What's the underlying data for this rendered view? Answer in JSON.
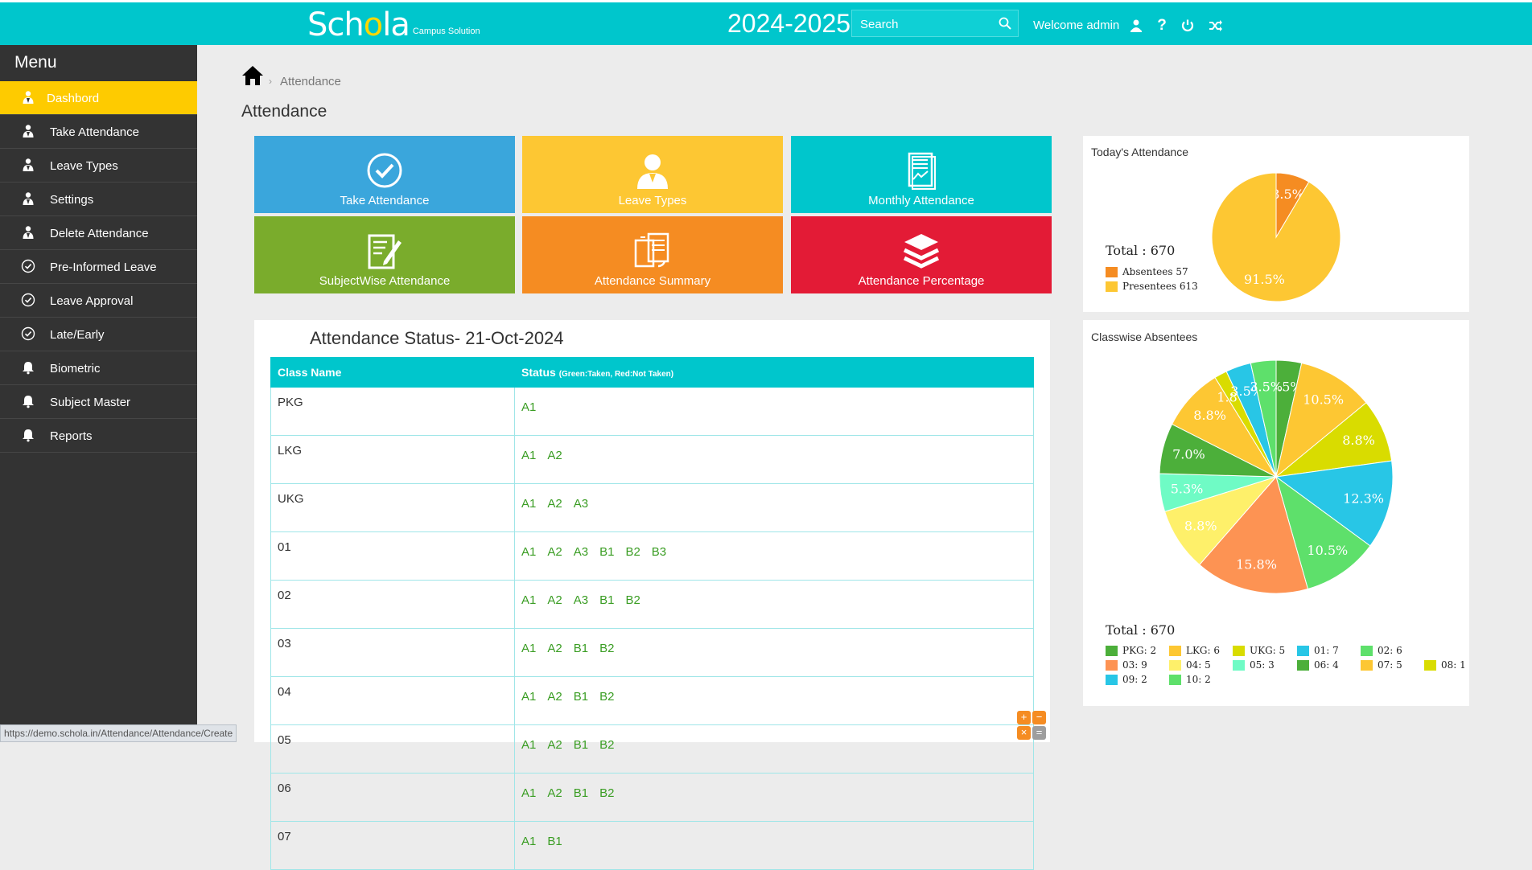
{
  "header": {
    "brand": "Schola",
    "brand_sub": "Campus Solution",
    "year": "2024-2025",
    "search_placeholder": "Search",
    "welcome": "Welcome admin"
  },
  "sidebar": {
    "title": "Menu",
    "items": [
      {
        "label": "Dashbord",
        "icon": "user-icon",
        "active": true
      },
      {
        "label": "Take Attendance",
        "icon": "user-icon"
      },
      {
        "label": "Leave Types",
        "icon": "user-icon"
      },
      {
        "label": "Settings",
        "icon": "user-icon"
      },
      {
        "label": "Delete Attendance",
        "icon": "user-icon"
      },
      {
        "label": "Pre-Informed Leave",
        "icon": "check-circle-icon"
      },
      {
        "label": "Leave Approval",
        "icon": "check-circle-icon"
      },
      {
        "label": "Late/Early",
        "icon": "check-circle-icon"
      },
      {
        "label": "Biometric",
        "icon": "bell-icon"
      },
      {
        "label": "Subject Master",
        "icon": "bell-icon"
      },
      {
        "label": "Reports",
        "icon": "bell-icon"
      }
    ]
  },
  "breadcrumb": {
    "current": "Attendance"
  },
  "page_title": "Attendance",
  "tiles": [
    {
      "label": "Take Attendance",
      "color": "#3aa6dc",
      "icon": "check-circle-icon"
    },
    {
      "label": "Leave Types",
      "color": "#fdc733",
      "icon": "person-icon"
    },
    {
      "label": "Monthly Attendance",
      "color": "#00c6cc",
      "icon": "report-icon"
    },
    {
      "label": "SubjectWise Attendance",
      "color": "#7aac2c",
      "icon": "edit-document-icon"
    },
    {
      "label": "Attendance Summary",
      "color": "#f58c22",
      "icon": "documents-icon"
    },
    {
      "label": "Attendance Percentage",
      "color": "#e31b36",
      "icon": "layers-icon"
    }
  ],
  "attendance_status": {
    "title": "Attendance Status- 21-Oct-2024",
    "col_class": "Class Name",
    "col_status": "Status",
    "col_status_note": "(Green:Taken, Red:Not Taken)",
    "rows": [
      {
        "class": "PKG",
        "sections": [
          "A1"
        ]
      },
      {
        "class": "LKG",
        "sections": [
          "A1",
          "A2"
        ]
      },
      {
        "class": "UKG",
        "sections": [
          "A1",
          "A2",
          "A3"
        ]
      },
      {
        "class": "01",
        "sections": [
          "A1",
          "A2",
          "A3",
          "B1",
          "B2",
          "B3"
        ]
      },
      {
        "class": "02",
        "sections": [
          "A1",
          "A2",
          "A3",
          "B1",
          "B2"
        ]
      },
      {
        "class": "03",
        "sections": [
          "A1",
          "A2",
          "B1",
          "B2"
        ]
      },
      {
        "class": "04",
        "sections": [
          "A1",
          "A2",
          "B1",
          "B2"
        ]
      },
      {
        "class": "05",
        "sections": [
          "A1",
          "A2",
          "B1",
          "B2"
        ]
      },
      {
        "class": "06",
        "sections": [
          "A1",
          "A2",
          "B1",
          "B2"
        ]
      },
      {
        "class": "07",
        "sections": [
          "A1",
          "B1"
        ]
      }
    ]
  },
  "chart_data": [
    {
      "type": "pie",
      "title": "Today's Attendance",
      "total_label": "Total : 670",
      "slices": [
        {
          "name": "Absentees 57",
          "value": 57,
          "label": "8.5%",
          "color": "#f58c22"
        },
        {
          "name": "Presentees 613",
          "value": 613,
          "label": "91.5%",
          "color": "#fdc733"
        }
      ]
    },
    {
      "type": "pie",
      "title": "Classwise Absentees",
      "total_label": "Total : 670",
      "slices": [
        {
          "name": "PKG: 2",
          "value": 2,
          "label": "3.5%",
          "color": "#4caf3a"
        },
        {
          "name": "LKG: 6",
          "value": 6,
          "label": "10.5%",
          "color": "#fdc733"
        },
        {
          "name": "UKG: 5",
          "value": 5,
          "label": "8.8%",
          "color": "#d9dc00"
        },
        {
          "name": "01: 7",
          "value": 7,
          "label": "12.3%",
          "color": "#28c6e6"
        },
        {
          "name": "02: 6",
          "value": 6,
          "label": "10.5%",
          "color": "#5ee06b"
        },
        {
          "name": "03: 9",
          "value": 9,
          "label": "15.8%",
          "color": "#fd9353"
        },
        {
          "name": "04: 5",
          "value": 5,
          "label": "8.8%",
          "color": "#fef06a"
        },
        {
          "name": "05: 3",
          "value": 3,
          "label": "5.3%",
          "color": "#6ffbc5"
        },
        {
          "name": "06: 4",
          "value": 4,
          "label": "7.0%",
          "color": "#4caf3a"
        },
        {
          "name": "07: 5",
          "value": 5,
          "label": "8.8%",
          "color": "#fdc733"
        },
        {
          "name": "08: 1",
          "value": 1,
          "label": "1.8%",
          "color": "#d9dc00"
        },
        {
          "name": "09: 2",
          "value": 2,
          "label": "3.5%",
          "color": "#28c6e6"
        },
        {
          "name": "10: 2",
          "value": 2,
          "label": "3.5%",
          "color": "#5ee06b"
        }
      ]
    }
  ],
  "status_bar": {
    "url": "https://demo.schola.in/Attendance/Attendance/Create"
  },
  "calculator": {
    "plus": "+",
    "minus": "−",
    "times": "×",
    "equals": "="
  }
}
